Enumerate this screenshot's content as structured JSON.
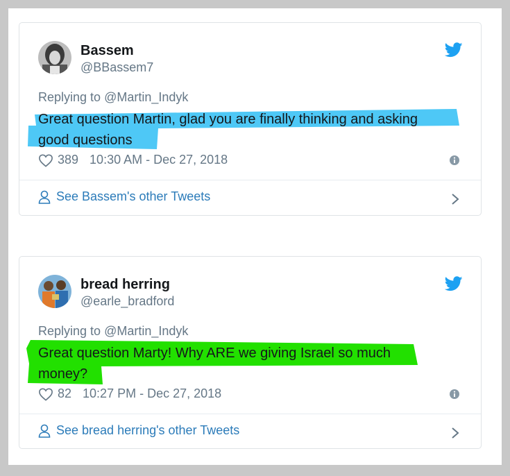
{
  "tweets": [
    {
      "name": "Bassem",
      "handle": "@BBassem7",
      "replying_prefix": "Replying to",
      "replying_to": "@Martin_Indyk",
      "text_line1": "Great question Martin, glad you are finally thinking and asking",
      "text_line2": "good questions",
      "likes": "389",
      "timestamp": "10:30 AM - Dec 27, 2018",
      "footer": "See Bassem's other Tweets",
      "highlight_color": "#4ec8f6"
    },
    {
      "name": "bread herring",
      "handle": "@earle_bradford",
      "replying_prefix": "Replying to",
      "replying_to": "@Martin_Indyk",
      "text_line1": "Great question Marty! Why ARE we giving Israel so much",
      "text_line2": "money?",
      "likes": "82",
      "timestamp": "10:27 PM - Dec 27, 2018",
      "footer": "See bread herring's other Tweets",
      "highlight_color": "#22e000"
    }
  ],
  "colors": {
    "twitter_blue": "#1da1f2",
    "link_blue": "#2b7bb9",
    "gray_text": "#657786"
  },
  "icons": [
    "twitter-bird-icon",
    "heart-icon",
    "info-icon",
    "person-icon",
    "chevron-right-icon"
  ]
}
